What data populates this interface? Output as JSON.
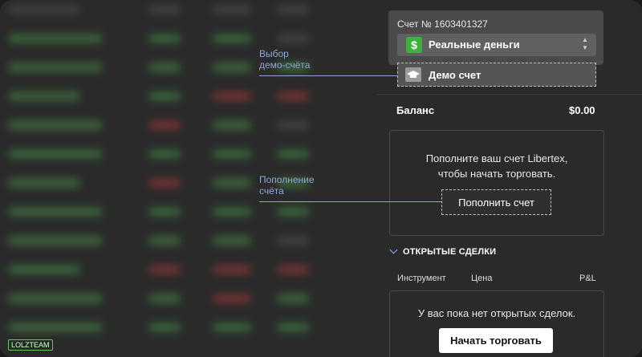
{
  "account": {
    "label": "Счет № 1603401327",
    "selected": "Реальные деньги",
    "option_demo": "Демо счет",
    "dollar_symbol": "$"
  },
  "balance": {
    "label": "Баланс",
    "value": "$0.00"
  },
  "deposit": {
    "line1": "Пополните ваш счет Libertex,",
    "line2": "чтобы начать торговать.",
    "button": "Пополнить счет"
  },
  "open_trades": {
    "title": "ОТКРЫТЫЕ СДЕЛКИ",
    "columns": [
      "Инструмент",
      "Цена",
      "P&L"
    ],
    "empty_text": "У вас пока нет открытых сделок.",
    "start_button": "Начать торговать"
  },
  "annotations": {
    "demo_line1": "Выбор",
    "demo_line2": "демо-счёта",
    "deposit_line1": "Пополнение",
    "deposit_line2": "счёта"
  },
  "watermark": "LOLZTEAM",
  "colors": {
    "panel_bg": "#2a2a2a",
    "accent_green": "#3db33d",
    "annotation_blue": "#8ea6d6"
  }
}
